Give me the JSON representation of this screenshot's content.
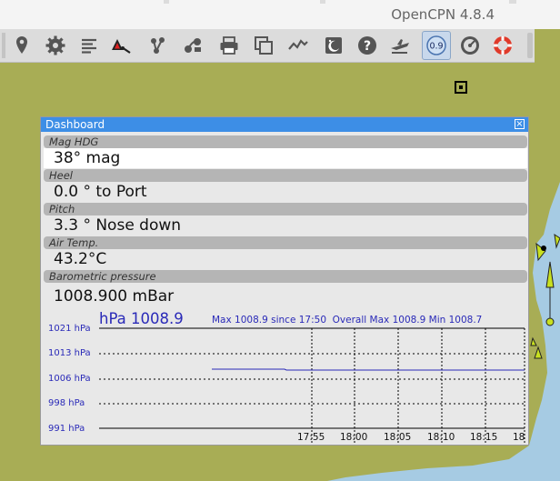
{
  "app": {
    "title": "OpenCPN 4.8.4"
  },
  "toolbar": {
    "items": [
      {
        "name": "mark-icon"
      },
      {
        "name": "settings-icon"
      },
      {
        "name": "route-list-icon"
      },
      {
        "name": "ais-alert-icon"
      },
      {
        "name": "create-route-icon"
      },
      {
        "name": "track-icon"
      },
      {
        "name": "print-icon"
      },
      {
        "name": "chart-windows-icon"
      },
      {
        "name": "tides-currents-icon"
      },
      {
        "name": "moon-icon"
      },
      {
        "name": "help-icon"
      },
      {
        "name": "plane-icon"
      },
      {
        "name": "zoom-scale-icon",
        "label": "0.9"
      },
      {
        "name": "dashboard-icon"
      },
      {
        "name": "mob-icon"
      }
    ]
  },
  "dashboard": {
    "title": "Dashboard",
    "close": "×",
    "instruments": [
      {
        "caption": "Mag HDG",
        "value": "38° mag"
      },
      {
        "caption": "Heel",
        "value": "0.0 ° to Port"
      },
      {
        "caption": "Pitch",
        "value": "3.3 ° Nose down"
      },
      {
        "caption": "Air Temp.",
        "value": "43.2°C"
      },
      {
        "caption": "Barometric pressure",
        "value": "1008.900 mBar"
      }
    ],
    "barograph": {
      "current": "hPa 1008.9",
      "stats": "Max 1008.9 since 17:50  Overall Max 1008.9 Min 1008.7",
      "y_ticks": [
        "1021 hPa",
        "1013 hPa",
        "1006 hPa",
        "998 hPa",
        "991 hPa"
      ],
      "x_ticks": [
        "17:55",
        "18:00",
        "18:05",
        "18:10",
        "18:15",
        "18"
      ],
      "colors": {
        "text": "#2a2ab8",
        "line": "#2a2ab8"
      }
    }
  },
  "colors": {
    "land": "#a8ad55",
    "sea": "#a6cbe3",
    "titlebar": "#3d8ee6"
  }
}
